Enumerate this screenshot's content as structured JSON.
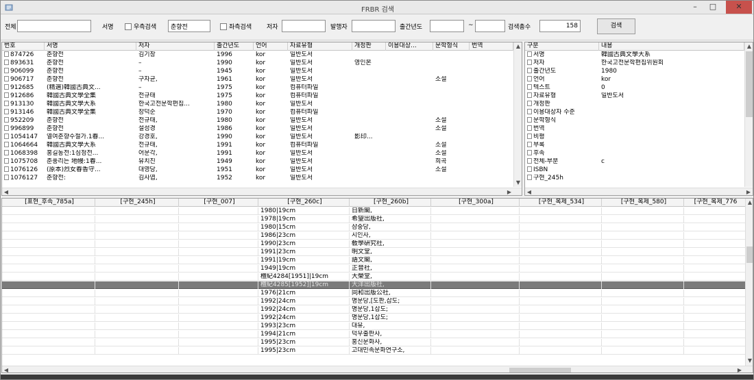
{
  "window": {
    "title": "FRBR 검색"
  },
  "search": {
    "all_label": "전체",
    "all_value": "",
    "title_label": "서명",
    "right_check_label": "우측검색",
    "title_value": "춘향전",
    "left_check_label": "좌측검색",
    "author_label": "저자",
    "author_value": "",
    "publisher_label": "발행자",
    "publisher_value": "",
    "year_label": "출간년도",
    "year_from": "",
    "year_sep": "~",
    "year_to": "",
    "count_label": "검색총수",
    "count_value": "158",
    "search_button": "검색"
  },
  "results": {
    "columns": [
      "번호",
      "서명",
      "저자",
      "출간년도",
      "언어",
      "자료유형",
      "개정판",
      "이용대상...",
      "문학형식",
      "번역"
    ],
    "rows": [
      [
        "874726",
        "춘향전",
        "김기창",
        "1996",
        "kor",
        "일반도서",
        "",
        "",
        "",
        ""
      ],
      [
        "893631",
        "춘향전",
        "–",
        "1990",
        "kor",
        "일반도서",
        "영인본",
        "",
        "",
        ""
      ],
      [
        "906099",
        "춘향전",
        "–",
        "1945",
        "kor",
        "일반도서",
        "",
        "",
        "",
        ""
      ],
      [
        "906717",
        "춘향전",
        "구자균,",
        "1961",
        "kor",
        "일반도서",
        "",
        "",
        "소설",
        ""
      ],
      [
        "912685",
        "(精選)韓國古典文...",
        "–",
        "1975",
        "kor",
        "컴퓨터파일",
        "",
        "",
        "",
        ""
      ],
      [
        "912686",
        "韓國古典文學全集",
        "전규태",
        "1975",
        "kor",
        "컴퓨터파일",
        "",
        "",
        "",
        ""
      ],
      [
        "913130",
        "韓國古典文學大系",
        "한국고전문학편집...",
        "1980",
        "kor",
        "일반도서",
        "",
        "",
        "",
        ""
      ],
      [
        "913146",
        "韓國古典文學全集",
        "장덕순",
        "1970",
        "kor",
        "컴퓨터파일",
        "",
        "",
        "",
        ""
      ],
      [
        "952209",
        "춘향전",
        "전규태,",
        "1980",
        "kor",
        "일반도서",
        "",
        "",
        "소설",
        ""
      ],
      [
        "996899",
        "춘향전",
        "설성경",
        "1986",
        "kor",
        "일반도서",
        "",
        "",
        "소설",
        ""
      ],
      [
        "1054147",
        "열여춘향수절가.1春...",
        "강경호,",
        "1990",
        "kor",
        "일반도서",
        "影印...",
        "",
        "",
        ""
      ],
      [
        "1064664",
        "韓國古典文學大系",
        "전규태,",
        "1991",
        "kor",
        "컴퓨터파일",
        "",
        "",
        "소설",
        ""
      ],
      [
        "1068398",
        "홍길동전:1심청전...",
        "어문각,",
        "1991",
        "kor",
        "일반도서",
        "",
        "",
        "소설",
        ""
      ],
      [
        "1075708",
        "춘풍리는 地幔:1春...",
        "유치진",
        "1949",
        "kor",
        "일반도서",
        "",
        "",
        "희곡",
        ""
      ],
      [
        "1076126",
        "(原本)烈女春香守...",
        "대영당,",
        "1951",
        "kor",
        "일반도서",
        "",
        "",
        "소설",
        ""
      ],
      [
        "1076127",
        "춘향전:",
        "김사엽,",
        "1952",
        "kor",
        "일반도서",
        "",
        "",
        "",
        ""
      ]
    ]
  },
  "detail": {
    "columns": [
      "구분",
      "내용"
    ],
    "rows": [
      [
        "서명",
        "韓國古典文學大系"
      ],
      [
        "저자",
        "한국고전문학편집위원회"
      ],
      [
        "출간년도",
        "1980"
      ],
      [
        "언어",
        "kor"
      ],
      [
        "텍스트",
        "0"
      ],
      [
        "자료유형",
        "일반도서"
      ],
      [
        "개정판",
        ""
      ],
      [
        "이용대상자 수준",
        ""
      ],
      [
        "문학형식",
        ""
      ],
      [
        "번역",
        ""
      ],
      [
        "비평",
        ""
      ],
      [
        "부록",
        ""
      ],
      [
        "후속",
        ""
      ],
      [
        "전체-부분",
        "c"
      ],
      [
        "ISBN",
        ""
      ],
      [
        "구현_245h",
        ""
      ]
    ]
  },
  "grid": {
    "columns": [
      "[표현_후속_785a]",
      "[구현_245h]",
      "[구현_007]",
      "[구현_260c]",
      "[구현_260b]",
      "[구현_300a]",
      "[구현_복제_534]",
      "[구현_복제_580]",
      "[구현_복제_776"
    ],
    "rows": [
      [
        "1980|19cm",
        "日新閣,"
      ],
      [
        "1978|19cm",
        "希望出版社,"
      ],
      [
        "1980|15cm",
        "삼중당,"
      ],
      [
        "1986|23cm",
        "시인사,"
      ],
      [
        "1990|23cm",
        "敎學硏究社,"
      ],
      [
        "1991|23cm",
        "明文堂,"
      ],
      [
        "1991|19cm",
        "語文閣,"
      ],
      [
        "1949|19cm",
        "正音社,"
      ],
      [
        "檀紀4284[1951]|19cm",
        "大榮堂,"
      ],
      [
        "檀紀4285[1952]|19cm",
        "大洋出版社,"
      ],
      [
        "1976|21cm",
        "同和出版公社,"
      ],
      [
        "1992|24cm",
        "명문당,[도판,삽도;"
      ],
      [
        "1992|24cm",
        "명문당,1삽도;"
      ],
      [
        "1992|24cm",
        "명문당,1삽도;"
      ],
      [
        "1993|23cm",
        "대유,"
      ],
      [
        "1994|21cm",
        "덕우출판사,"
      ],
      [
        "1995|23cm",
        "홍신문화사,"
      ],
      [
        "1995|23cm",
        "고대민족문화연구소,"
      ]
    ],
    "selected_index": 9
  },
  "colors": {
    "selected_row": "#7b7b7b",
    "close_button": "#c7514c",
    "panel_bg": "#ffffff",
    "window_bg": "#f0f0f0"
  }
}
